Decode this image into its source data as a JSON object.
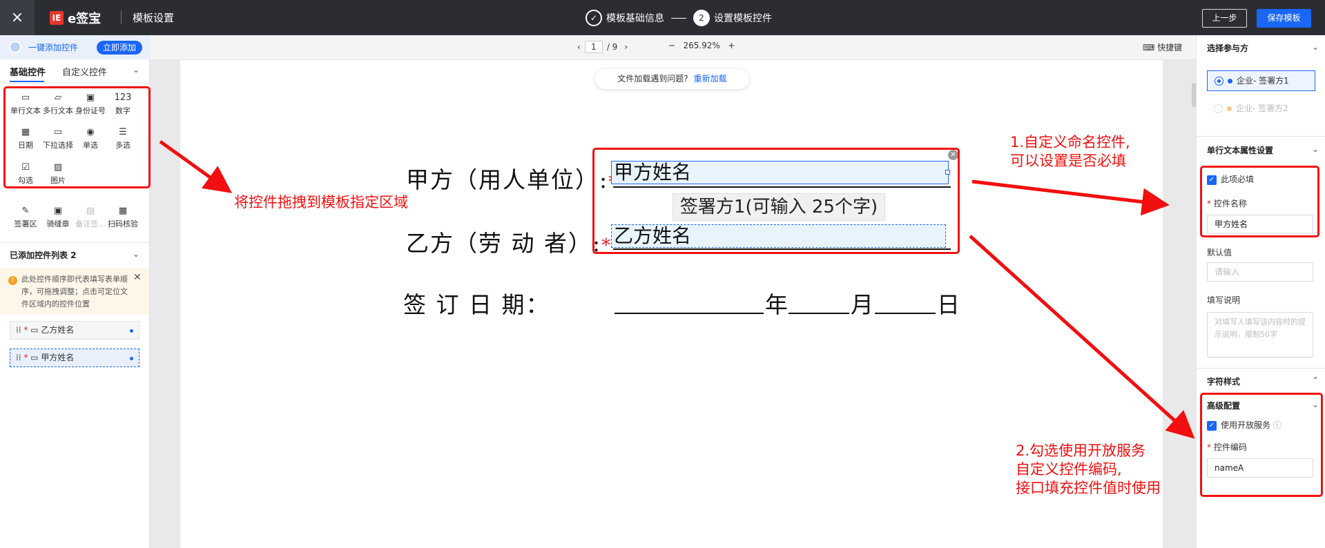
{
  "topbar": {
    "close_icon": "×",
    "logo_text": "e签宝",
    "logo_mark": "IE",
    "title": "模板设置",
    "steps": [
      {
        "index": "✓",
        "label": "模板基础信息"
      },
      {
        "index": "2",
        "label": "设置模板控件"
      }
    ],
    "prev_label": "上一步",
    "save_label": "保存模板"
  },
  "left": {
    "quick_text": "一键添加控件",
    "quick_button": "立即添加",
    "tabs": [
      "基础控件",
      "自定义控件"
    ],
    "controls": [
      {
        "icon": "▭",
        "label": "单行文本"
      },
      {
        "icon": "▱",
        "label": "多行文本"
      },
      {
        "icon": "▣",
        "label": "身份证号"
      },
      {
        "icon": "123",
        "label": "数字"
      },
      {
        "icon": "▦",
        "label": "日期"
      },
      {
        "icon": "▭",
        "label": "下拉选择"
      },
      {
        "icon": "◉",
        "label": "单选"
      },
      {
        "icon": "☰",
        "label": "多选"
      },
      {
        "icon": "☑",
        "label": "勾选"
      },
      {
        "icon": "▨",
        "label": "图片"
      }
    ],
    "controls2": [
      {
        "icon": "✎",
        "label": "签署区"
      },
      {
        "icon": "▣",
        "label": "骑缝章"
      },
      {
        "icon": "▤",
        "label": "备注签..."
      },
      {
        "icon": "▦",
        "label": "扫码核验"
      }
    ],
    "list_header": "已添加控件列表 2",
    "notice": "此处控件顺序即代表填写表单顺序，可拖拽调整；点击可定位文件区域内的控件位置",
    "list_items": [
      "乙方姓名",
      "甲方姓名"
    ]
  },
  "toolbar": {
    "page_current": "1",
    "page_total": "/ 9",
    "zoom": "265.92%",
    "shortcut": "快捷键"
  },
  "toast": {
    "text": "文件加载遇到问题?",
    "link": "重新加载"
  },
  "document": {
    "line_a": "甲方（用人单位）:",
    "line_b": "乙方（劳 动 者）:",
    "line_c": "签  订  日  期：",
    "field_a": "甲方姓名",
    "field_b": "乙方姓名",
    "sign_tip": "签署方1(可输入 25个字)",
    "date_year": "年",
    "date_month": "月",
    "date_day": "日",
    "star": "*"
  },
  "annotations": {
    "a1": "将控件拖拽到模板指定区域",
    "a2_line1": "1.自定义命名控件,",
    "a2_line2": "可以设置是否必填",
    "a3_line1": "2.勾选使用开放服务",
    "a3_line2": "自定义控件编码,",
    "a3_line3": "接口填充控件值时使用"
  },
  "right": {
    "choose_party": "选择参与方",
    "party1": "企业- 签署方1",
    "party2": "企业- 签署方2",
    "props_header": "单行文本属性设置",
    "required_label": "此项必填",
    "name_label": "控件名称",
    "name_value": "甲方姓名",
    "default_label": "默认值",
    "default_placeholder": "请输入",
    "desc_label": "填写说明",
    "desc_placeholder": "对填写人填写该内容时的提示说明，限制50字",
    "font_style": "字符样式",
    "advanced": "高级配置",
    "open_service": "使用开放服务",
    "code_label": "控件编码",
    "code_value": "nameA"
  },
  "colors": {
    "accent": "#1a66f5",
    "annotation": "#f20f0f",
    "topbar": "#2b2d33",
    "party1_dot": "#1a66f5",
    "party2_dot": "#f4c98a"
  }
}
